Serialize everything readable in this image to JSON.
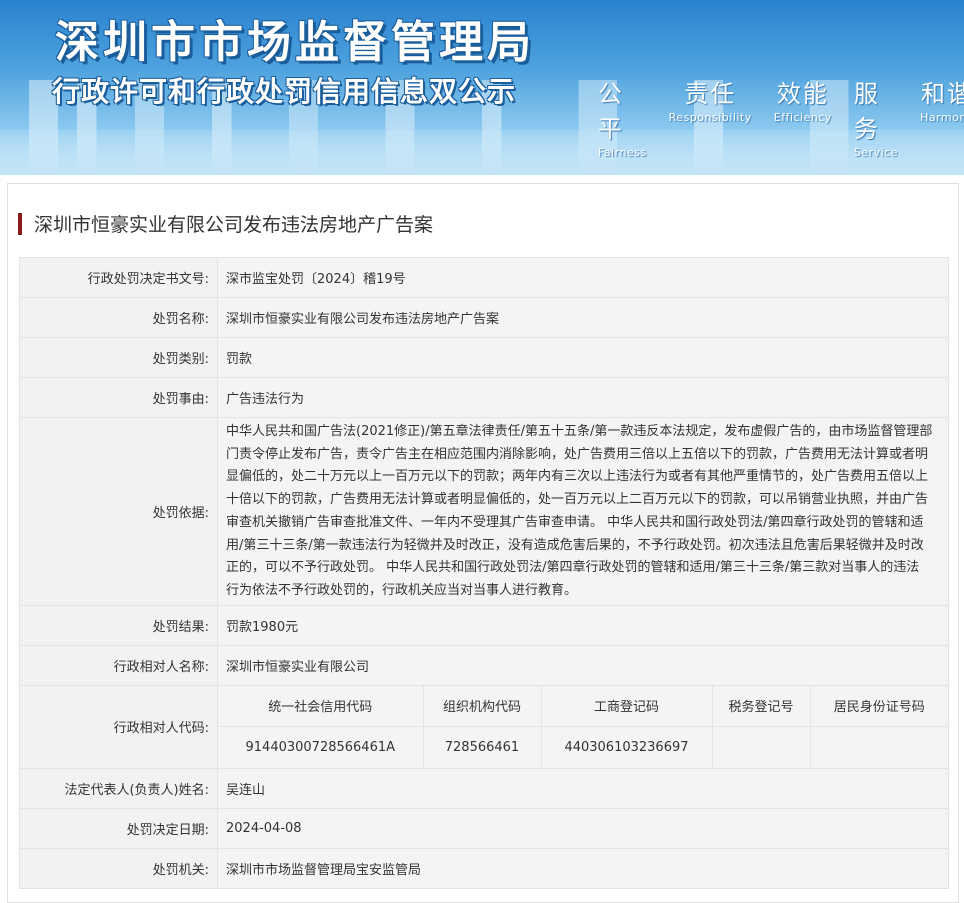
{
  "banner": {
    "title": "深圳市市场监督管理局",
    "subtitle": "行政许可和行政处罚信用信息双公示",
    "slogans": [
      {
        "zh": "公平",
        "en": "Fairness"
      },
      {
        "zh": "责任",
        "en": "Responsibility"
      },
      {
        "zh": "效能",
        "en": "Efficiency"
      },
      {
        "zh": "服务",
        "en": "Service"
      },
      {
        "zh": "和谐",
        "en": "Harmony"
      }
    ]
  },
  "case_title": "深圳市恒豪实业有限公司发布违法房地产广告案",
  "fields": {
    "doc_no": {
      "label": "行政处罚决定书文号:",
      "value": "深市监宝处罚〔2024〕稽19号"
    },
    "name": {
      "label": "处罚名称:",
      "value": "深圳市恒豪实业有限公司发布违法房地产广告案"
    },
    "category": {
      "label": "处罚类别:",
      "value": "罚款"
    },
    "reason": {
      "label": "处罚事由:",
      "value": "广告违法行为"
    },
    "basis": {
      "label": "处罚依据:",
      "lines": [
        "中华人民共和国广告法(2021修正)/第五章法律责任/第五十五条/第一款违反本法规定，发布虚假广告的，由市场监督管理部",
        "门责令停止发布广告，责令广告主在相应范围内消除影响，处广告费用三倍以上五倍以下的罚款，广告费用无法计算或者明",
        "显偏低的，处二十万元以上一百万元以下的罚款；两年内有三次以上违法行为或者有其他严重情节的，处广告费用五倍以上",
        "十倍以下的罚款，广告费用无法计算或者明显偏低的，处一百万元以上二百万元以下的罚款，可以吊销营业执照，并由广告",
        "审查机关撤销广告审查批准文件、一年内不受理其广告审查申请。 中华人民共和国行政处罚法/第四章行政处罚的管辖和适",
        "用/第三十三条/第一款违法行为轻微并及时改正，没有造成危害后果的，不予行政处罚。初次违法且危害后果轻微并及时改",
        "正的，可以不予行政处罚。 中华人民共和国行政处罚法/第四章行政处罚的管辖和适用/第三十三条/第三款对当事人的违法",
        "行为依法不予行政处罚的，行政机关应当对当事人进行教育。"
      ]
    },
    "result": {
      "label": "处罚结果:",
      "value": "罚款1980元"
    },
    "party": {
      "label": "行政相对人名称:",
      "value": "深圳市恒豪实业有限公司"
    },
    "codes": {
      "label": "行政相对人代码:",
      "headers": [
        "统一社会信用代码",
        "组织机构代码",
        "工商登记码",
        "税务登记号",
        "居民身份证号码"
      ],
      "values": [
        "91440300728566461A",
        "728566461",
        "440306103236697",
        "",
        ""
      ]
    },
    "legal_rep": {
      "label": "法定代表人(负责人)姓名:",
      "value": "吴连山"
    },
    "date": {
      "label": "处罚决定日期:",
      "value": "2024-04-08"
    },
    "authority": {
      "label": "处罚机关:",
      "value": "深圳市市场监督管理局宝安监管局"
    }
  },
  "colors": {
    "title_accent": "#8b1a1a",
    "banner_blue": "#2a82cf",
    "label_bg": "#f2f2f2",
    "value_bg": "#f4f4f4"
  }
}
